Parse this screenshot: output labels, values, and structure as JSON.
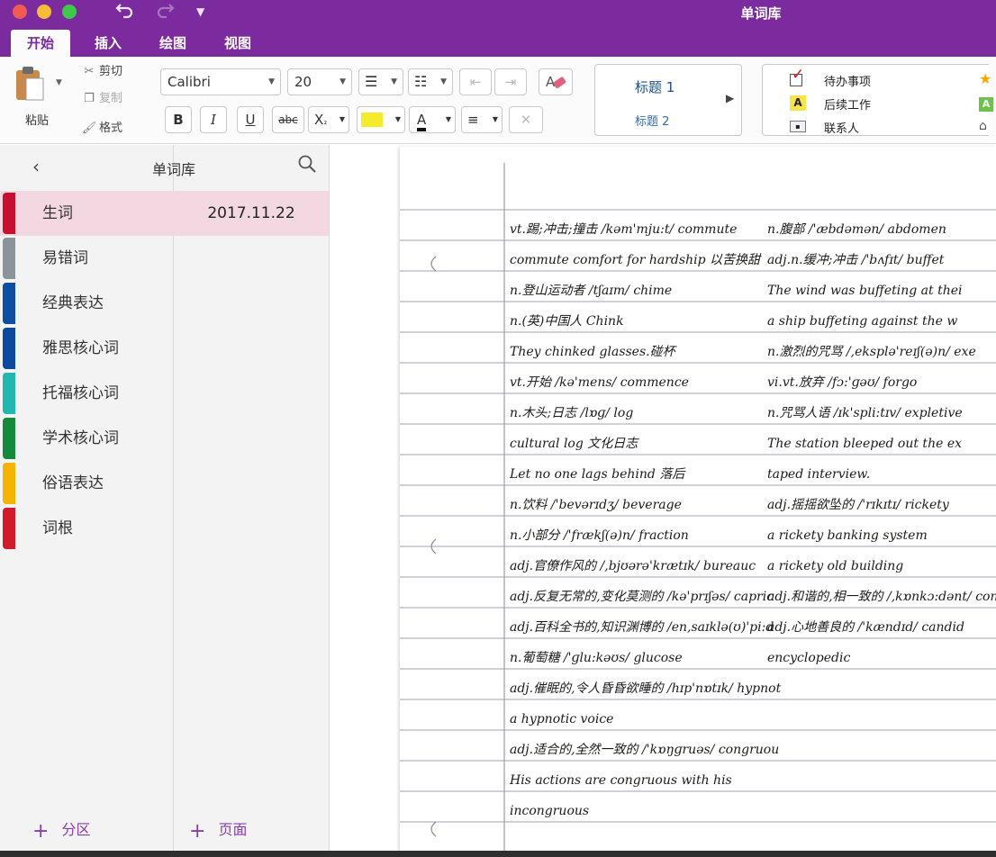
{
  "window": {
    "title": "单词库"
  },
  "quick_access": {
    "undo_icon": "undo-icon",
    "redo_icon": "redo-icon",
    "customize_icon": "caret-down-icon"
  },
  "tabs": [
    {
      "label": "开始",
      "active": true
    },
    {
      "label": "插入",
      "active": false
    },
    {
      "label": "绘图",
      "active": false
    },
    {
      "label": "视图",
      "active": false
    }
  ],
  "ribbon": {
    "clipboard": {
      "paste": "粘贴",
      "cut": "剪切",
      "copy": "复制",
      "format": "格式"
    },
    "font": {
      "family": "Calibri",
      "size": "20"
    },
    "format_buttons": {
      "bold": "B",
      "italic": "I",
      "underline": "U",
      "strike": "abc",
      "subscript": "X"
    },
    "styles": {
      "heading1": "标题 1",
      "heading2": "标题 2"
    },
    "tags": [
      {
        "label": "待办事项",
        "icon": "checkbox-icon"
      },
      {
        "label": "后续工作",
        "icon": "letter-a-icon"
      },
      {
        "label": "联系人",
        "icon": "contact-card-icon"
      }
    ]
  },
  "notebook": {
    "name": "单词库"
  },
  "sections": [
    {
      "label": "生词",
      "color": "#c8102e",
      "selected": true
    },
    {
      "label": "易错词",
      "color": "#8c949a",
      "selected": false
    },
    {
      "label": "经典表达",
      "color": "#0f4fa3",
      "selected": false
    },
    {
      "label": "雅思核心词",
      "color": "#0b4a9e",
      "selected": false
    },
    {
      "label": "托福核心词",
      "color": "#22b8b1",
      "selected": false
    },
    {
      "label": "学术核心词",
      "color": "#148a3b",
      "selected": false
    },
    {
      "label": "俗语表达",
      "color": "#f4b400",
      "selected": false
    },
    {
      "label": "词根",
      "color": "#d11a2a",
      "selected": false
    }
  ],
  "pages": [
    {
      "label": "2017.11.22",
      "selected": true
    }
  ],
  "footer": {
    "add_section": "分区",
    "add_page": "页面"
  },
  "page_content": {
    "type": "handwritten-notes-image",
    "lines": [
      "vt.踢;冲击;撞击 /kəm'mju:t/ commute",
      "commute comfort for hardship 以苦换甜",
      "n.登山运动者 /tʃaɪm/ chime",
      "n.(英)中国人 Chink",
      "They chinked glasses.碰杯",
      "vt.开始 /kə'mens/ commence",
      "n.木头;日志 /lɒɡ/ log",
      "cultural log 文化日志",
      "Let no one lags behind 落后",
      "n.饮料 /'bevərɪdʒ/ beverage",
      "n.小部分 /'frækʃ(ə)n/ fraction",
      "adj.官僚作风的 /,bjʊərə'krætɪk/ bureaucratic",
      "adj.反复无常的,变化莫测的 /kə'prɪʃəs/ capricious",
      "adj.百科全书的,知识渊博的 /en,saɪklə(ʊ)'pi:dɪk/ encyclopedic",
      "n.葡萄糖 /'ɡlu:kəʊs/ glucose",
      "adj.催眠的,令人昏昏欲睡的 /hɪp'nɒtɪk/ hypnotic",
      "a hypnotic voice",
      "adj.适合的,全然一致的 /'kɒŋɡruəs/ congruous",
      "His actions are congruous with his principles.",
      "incongruous",
      "n.腹部 /'æbdəmən/ abdomen",
      "adj.n.缓冲;冲击 /'bʌfɪt/ buffet",
      "The wind was buffeting at their back",
      "a ship buffeting against the wind",
      "n.激烈的咒骂 /,eksplə'reɪʃ(ə)n/ execration",
      "vi.vt.放弃 /fɔ:'ɡəʊ/ forgo",
      "n.咒骂人语 /ɪk'spli:tɪv/ expletive",
      "The station bleeped out the expletive",
      "taped interview.",
      "adj.摇摇欲坠的 /'rɪkɪtɪ/ rickety",
      "a rickety banking system",
      "a rickety old building",
      "adj.和谐的,相一致的 /,kɒnkɔ:dənt/ concordant",
      "adj.心地善良的 /'kændɪd/ candid",
      "encyclopedic"
    ]
  }
}
